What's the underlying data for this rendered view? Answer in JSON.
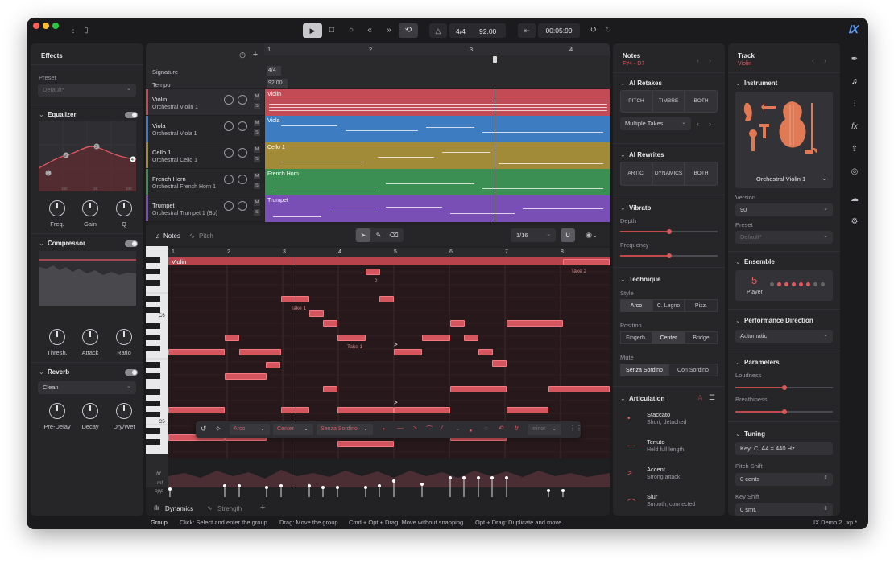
{
  "transport": {
    "time_sig": "4/4",
    "tempo": "92.00",
    "time": "00:05:99"
  },
  "effects": {
    "title": "Effects",
    "preset_label": "Preset",
    "preset_value": "Default*",
    "eq": {
      "title": "Equalizer",
      "freq": "Freq.",
      "gain": "Gain",
      "q": "Q",
      "nodes": [
        "1",
        "2",
        "3",
        "4"
      ],
      "axis": [
        "100",
        "1K",
        "10K"
      ]
    },
    "comp": {
      "title": "Compressor",
      "thresh": "Thresh.",
      "attack": "Attack",
      "ratio": "Ratio"
    },
    "reverb": {
      "title": "Reverb",
      "preset": "Clean",
      "predelay": "Pre-Delay",
      "decay": "Decay",
      "drywet": "Dry/Wet"
    }
  },
  "arrange": {
    "signature_label": "Signature",
    "tempo_label": "Tempo",
    "signature": "4/4",
    "tempo": "92.00",
    "bars": [
      "1",
      "2",
      "3",
      "4"
    ],
    "tracks": [
      {
        "name": "Violin",
        "sub": "Orchestral Violin 1",
        "color": "#c24b55"
      },
      {
        "name": "Viola",
        "sub": "Orchestral Viola 1",
        "color": "#3e7cc1"
      },
      {
        "name": "Cello 1",
        "sub": "Orchestral Cello 1",
        "color": "#a28b38"
      },
      {
        "name": "French Horn",
        "sub": "Orchestral French Horn 1",
        "color": "#3c8f52"
      },
      {
        "name": "Trumpet",
        "sub": "Orchestral Trumpet 1 (Bb)",
        "color": "#7a4fb5"
      }
    ]
  },
  "editor": {
    "notes_tab": "Notes",
    "pitch_tab": "Pitch",
    "quantize": "1/16",
    "clip": "Violin",
    "bars": [
      "1",
      "2",
      "3",
      "4",
      "5",
      "6",
      "7",
      "8"
    ],
    "keys": [
      "C6",
      "C5"
    ],
    "takes": [
      "Take 2",
      "Take 1",
      "Take 1",
      "2"
    ],
    "dyn_labels": [
      "fff",
      "mf",
      "ppp"
    ],
    "toolbar": {
      "arco": "Arco",
      "center": "Center",
      "sordino": "Senza Sordino",
      "scale": "minor"
    },
    "dyn_tab": "Dynamics",
    "strength_tab": "Strength"
  },
  "notes": {
    "title": "Notes",
    "range": "F#4 - D7",
    "retakes": {
      "title": "AI Retakes",
      "pitch": "PITCH",
      "timbre": "TIMBRE",
      "both": "BOTH",
      "takes": "Multiple Takes"
    },
    "rewrites": {
      "title": "AI Rewrites",
      "artic": "ARTIC.",
      "dynamics": "DYNAMICS",
      "both": "BOTH"
    },
    "vibrato": {
      "title": "Vibrato",
      "depth": "Depth",
      "frequency": "Frequency",
      "depth_level": 0.5,
      "freq_level": 0.5
    },
    "technique": {
      "title": "Technique",
      "style": "Style",
      "arco": "Arco",
      "clegno": "C. Legno",
      "pizz": "Pizz.",
      "position": "Position",
      "fingerb": "Fingerb.",
      "center": "Center",
      "bridge": "Bridge",
      "mute": "Mute",
      "senza": "Senza Sordino",
      "con": "Con Sordino"
    },
    "articulation": {
      "title": "Articulation",
      "items": [
        {
          "sym": "•",
          "name": "Staccato",
          "desc": "Short, detached"
        },
        {
          "sym": "—",
          "name": "Tenuto",
          "desc": "Held full length"
        },
        {
          "sym": ">",
          "name": "Accent",
          "desc": "Strong attack"
        },
        {
          "sym": "⌒",
          "name": "Slur",
          "desc": "Smooth, connected"
        }
      ]
    }
  },
  "track": {
    "title": "Track",
    "name": "Violin",
    "instrument": {
      "title": "Instrument",
      "name": "Orchestral Violin 1",
      "version_label": "Version",
      "version": "90",
      "preset_label": "Preset",
      "preset": "Default*"
    },
    "ensemble": {
      "title": "Ensemble",
      "count": "5",
      "label": "Player",
      "active": 5,
      "total": 8
    },
    "perf": {
      "title": "Performance Direction",
      "value": "Automatic"
    },
    "params": {
      "title": "Parameters",
      "loudness": "Loudness",
      "breathiness": "Breathiness",
      "loud_level": 0.5,
      "breath_level": 0.5
    },
    "tuning": {
      "title": "Tuning",
      "key": "Key: C, A4 = 440 Hz",
      "pitch_shift_label": "Pitch Shift",
      "pitch_shift": "0 cents",
      "key_shift_label": "Key Shift",
      "key_shift": "0 smt."
    }
  },
  "status": {
    "group": "Group",
    "hints": [
      "Click: Select and enter the group",
      "Drag: Move the group",
      "Cmd + Opt + Drag: Move without snapping",
      "Opt + Drag: Duplicate and move"
    ],
    "file": "IX Demo 2 .ixp *"
  },
  "colors": {
    "accent": "#d4555d",
    "bg": "#1b1b1e",
    "panel": "#262629"
  }
}
